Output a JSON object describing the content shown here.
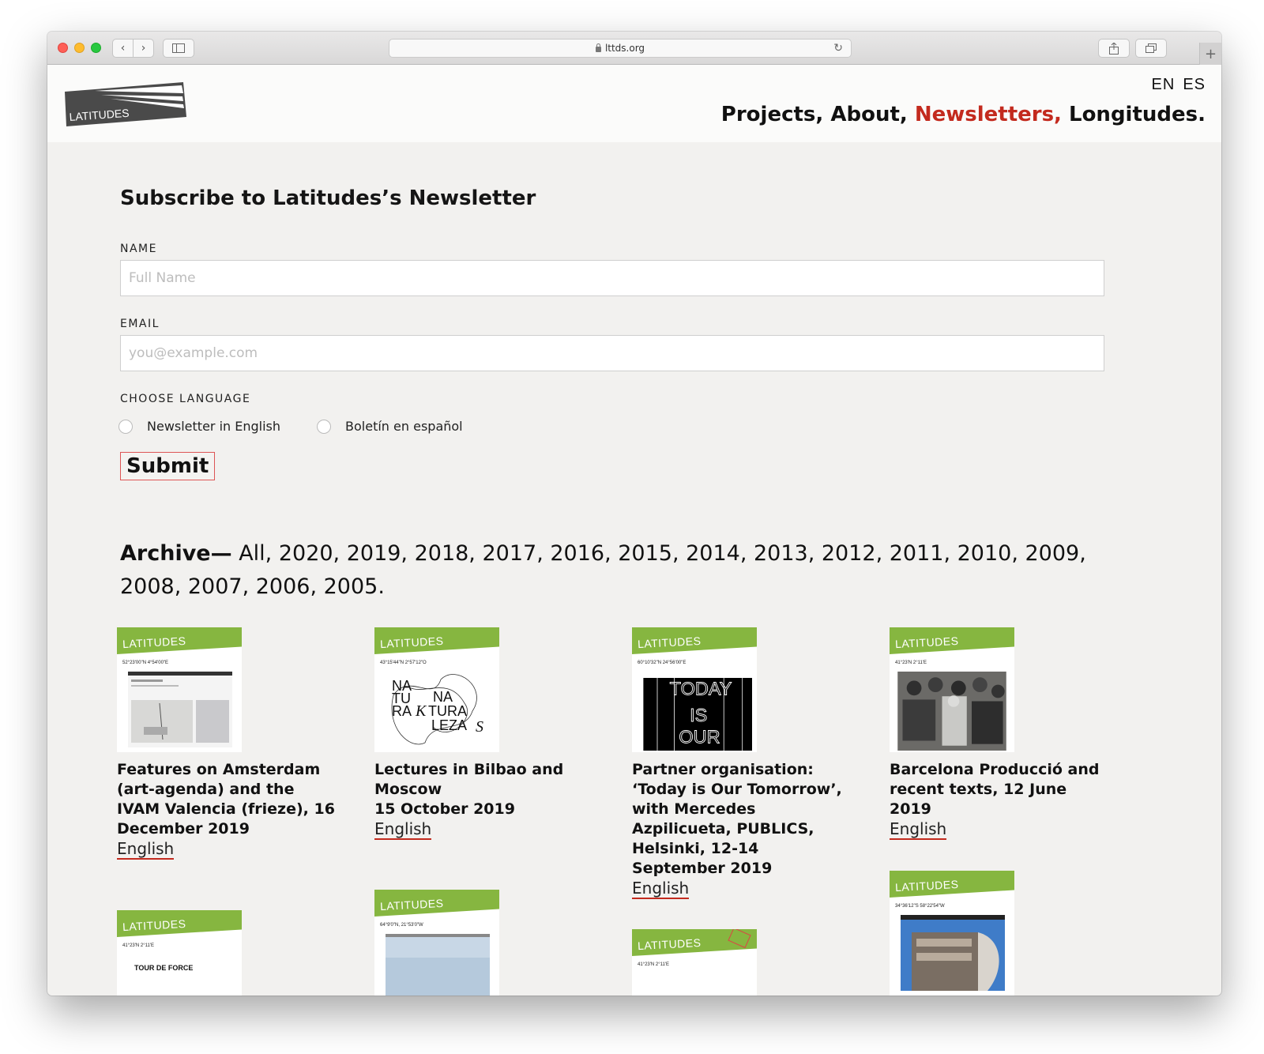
{
  "browser": {
    "url": "lttds.org"
  },
  "header": {
    "logo_text": "LATITUDES",
    "lang_options": [
      "EN",
      "ES"
    ],
    "nav": [
      {
        "label": "Projects,"
      },
      {
        "label": "About,"
      },
      {
        "label": "Newsletters,"
      },
      {
        "label": "Longitudes."
      }
    ],
    "active_nav": "Newsletters,",
    "accent_color": "#c32a1e"
  },
  "form": {
    "title": "Subscribe to Latitudes’s Newsletter",
    "name_label": "NAME",
    "name_placeholder": "Full Name",
    "email_label": "EMAIL",
    "email_placeholder": "you@example.com",
    "language_label": "CHOOSE LANGUAGE",
    "options": [
      "Newsletter in English",
      "Boletín en español"
    ],
    "submit_label": "Submit"
  },
  "archive": {
    "label": "Archive—",
    "years": "All, 2020, 2019, 2018, 2017, 2016, 2015, 2014, 2013, 2012, 2011, 2010, 2009, 2008, 2007, 2006, 2005."
  },
  "cards": [
    {
      "coords": "52°23'00\"N 4°54'00\"E",
      "title": "Features on Amsterdam (art-agenda) and the IVAM Valencia (frieze), 16 December 2019",
      "link": "English"
    },
    {
      "coords": "43°15'44\"N 2°57'12\"O",
      "title": "Lectures in Bilbao and Moscow\n15 October 2019",
      "link": "English",
      "poster_words": [
        "NA",
        "TU",
        "RA",
        "K",
        "NA",
        "TURA",
        "LEZA",
        "S"
      ]
    },
    {
      "coords": "60°10'32\"N 24°56'00\"E",
      "title": "Partner organisation: ‘Today is Our Tomorrow’, with Mercedes Azpilicueta, PUBLICS, Helsinki, 12-14 September 2019",
      "link": "English",
      "poster_words": [
        "TODAY",
        "IS",
        "OUR"
      ]
    },
    {
      "coords": "41°23'N 2°11'E",
      "title": "Barcelona Producció and recent texts, 12 June 2019",
      "link": "English"
    },
    {
      "coords": "41°23'N 2°11'E",
      "subhead": "TOUR DE FORCE"
    },
    {
      "coords": "64°9'0\"N, 21°53'0\"W"
    },
    {
      "coords": "41°23'N 2°11'E"
    },
    {
      "coords": "34°36'12\"S 58°22'54\"W"
    }
  ],
  "brand_green": "#86b640"
}
